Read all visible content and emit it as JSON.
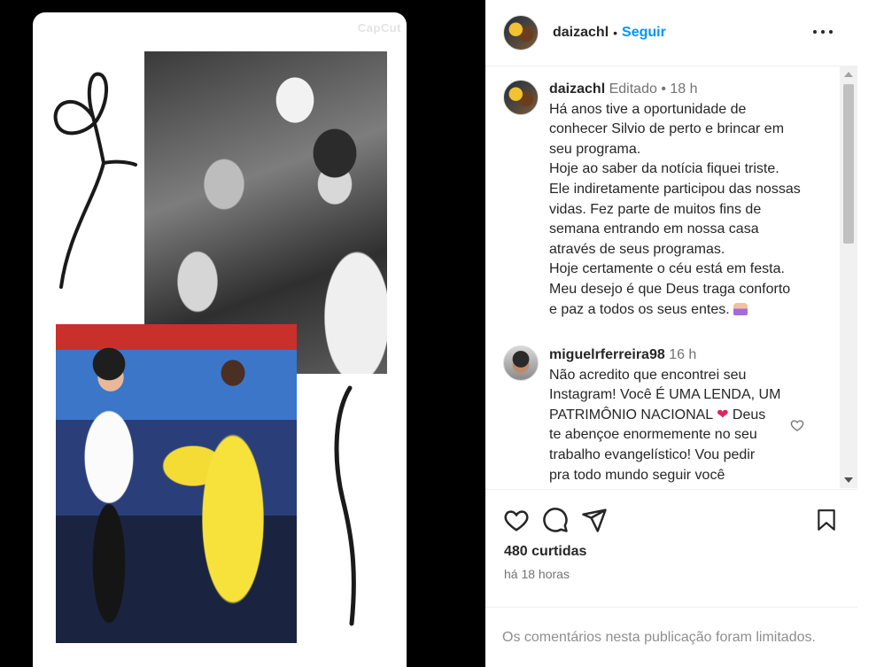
{
  "media": {
    "watermark": "CapCut"
  },
  "header": {
    "username": "daizachl",
    "follow_label": "Seguir"
  },
  "caption": {
    "username": "daizachl",
    "edited_label": "Editado",
    "time": "18 h",
    "lines": [
      "Há anos tive a oportunidade de",
      "conhecer Silvio de perto e brincar em",
      "seu programa.",
      "Hoje ao saber da notícia fiquei triste.",
      "Ele indiretamente participou das nossas",
      "vidas. Fez parte de muitos fins de",
      "semana entrando em nossa casa",
      "através de seus programas.",
      "Hoje certamente o céu está em festa.",
      "Meu desejo é que Deus traga conforto",
      "e paz a todos os seus entes."
    ]
  },
  "comment": {
    "username": "miguelrferreira98",
    "time": "16 h",
    "lines": [
      "Não acredito que encontrei seu",
      "Instagram! Você É UMA LENDA, UM",
      "PATRIMÔNIO NACIONAL",
      "Deus",
      "te abençoe enormemente no seu",
      "trabalho evangelístico! Vou pedir",
      "pra todo mundo seguir você"
    ]
  },
  "actions": {
    "likes": "480 curtidas",
    "posted": "há 18 horas"
  },
  "footer": {
    "notice": "Os comentários nesta publicação foram limitados."
  },
  "colors": {
    "accent": "#0095f6",
    "heart": "#e0245e",
    "muted": "#737373"
  }
}
